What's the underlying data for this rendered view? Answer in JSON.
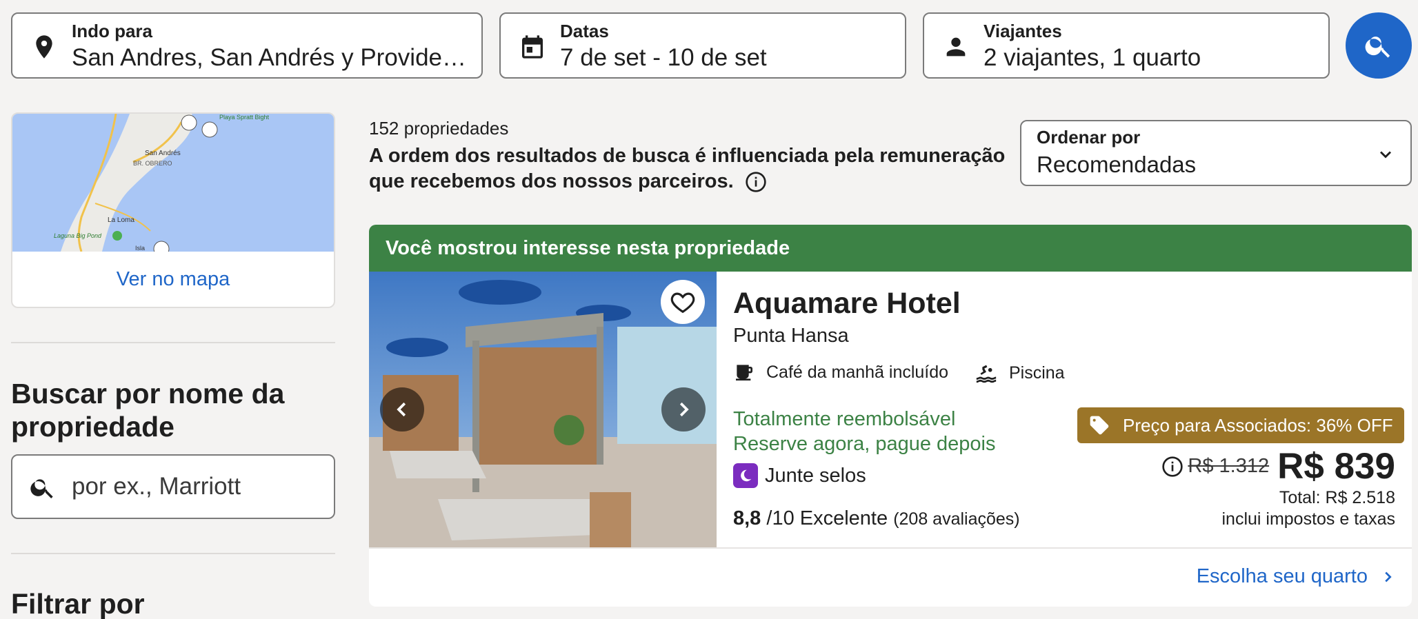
{
  "search_bar": {
    "destination": {
      "label": "Indo para",
      "value": "San Andres, San Andrés y Providencia, Colombia"
    },
    "dates": {
      "label": "Datas",
      "value": "7 de set - 10 de set"
    },
    "travelers": {
      "label": "Viajantes",
      "value": "2 viajantes, 1 quarto"
    }
  },
  "sidebar": {
    "map_link": "Ver no mapa",
    "search_title": "Buscar por nome da propriedade",
    "search_placeholder": "por ex., Marriott",
    "filter_title": "Filtrar por",
    "map_labels": {
      "place1": "San Andrés",
      "place2": "BR. OBRERO",
      "place3": "La Loma",
      "place4": "Laguna Big Pond",
      "place5": "Playa Spratt Bight",
      "place6": "Isla"
    }
  },
  "results": {
    "count": "152 propriedades",
    "disclaimer": "A ordem dos resultados de busca é influenciada pela remuneração que recebemos dos nossos parceiros.",
    "sort": {
      "label": "Ordenar por",
      "value": "Recomendadas"
    }
  },
  "listing": {
    "banner": "Você mostrou interesse nesta propriedade",
    "name": "Aquamare Hotel",
    "location": "Punta Hansa",
    "amenities": [
      "Café da manhã incluído",
      "Piscina"
    ],
    "refundable": "Totalmente reembolsável",
    "pay_later": "Reserve agora, pague depois",
    "rewards": "Junte selos",
    "rating_score": "8,8",
    "rating_scale": "/10 Excelente",
    "rating_reviews": "(208 avaliações)",
    "deal_badge": "Preço para Associados: 36% OFF",
    "old_price": "R$ 1.312",
    "price": "R$ 839",
    "total": "Total: R$ 2.518",
    "taxes_note": "inclui impostos e taxas",
    "cta": "Escolha seu quarto"
  },
  "colors": {
    "brand_blue": "#1f66c8",
    "banner_green": "#3c8245",
    "deal_gold": "#9b7528",
    "rewards_purple": "#7b2cbf"
  }
}
